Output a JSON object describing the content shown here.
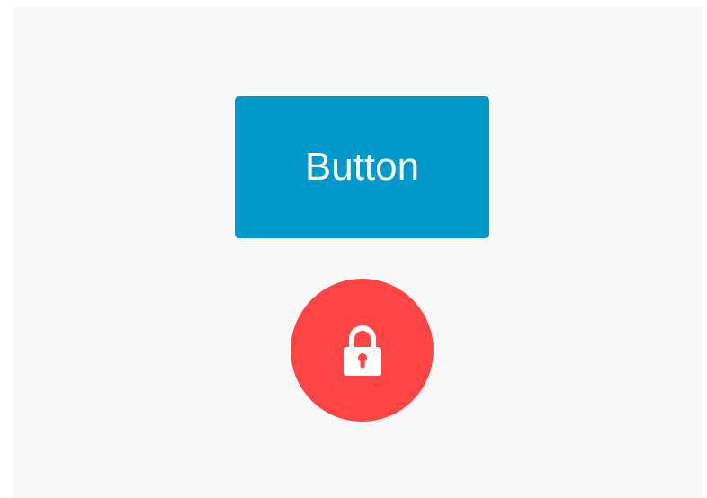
{
  "primary_button": {
    "label": "Button",
    "color": "#0099cc"
  },
  "lock_button": {
    "icon": "lock-icon",
    "color": "#ff4444",
    "icon_color": "#ffffff"
  },
  "background_color": "#f9f9f9"
}
